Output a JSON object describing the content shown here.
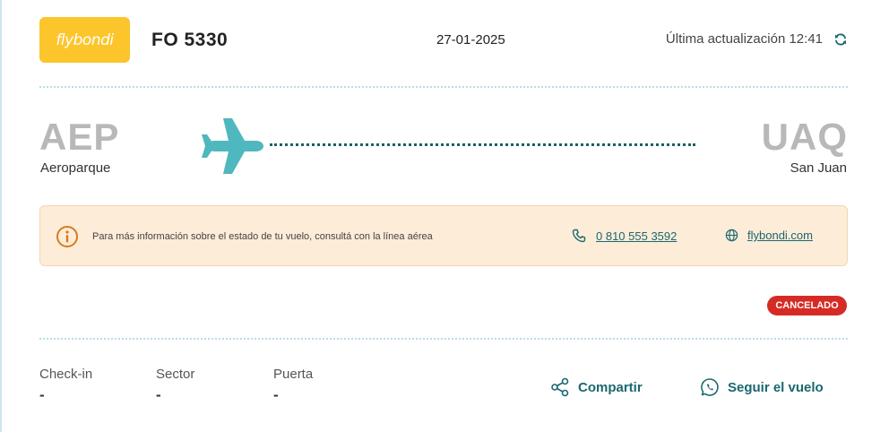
{
  "header": {
    "logo_text": "flybondi",
    "flight_number": "FO 5330",
    "date": "27-01-2025",
    "last_update": "Última actualización 12:41"
  },
  "route": {
    "origin": {
      "code": "AEP",
      "name": "Aeroparque"
    },
    "destination": {
      "code": "UAQ",
      "name": "San Juan"
    }
  },
  "info": {
    "message": "Para más información sobre el estado de tu vuelo, consultá con la línea aérea",
    "phone": "0 810 555 3592",
    "website": "flybondi.com"
  },
  "status": {
    "label": "CANCELADO",
    "color": "#d62b25"
  },
  "details": [
    {
      "label": "Check-in",
      "value": "-"
    },
    {
      "label": "Sector",
      "value": "-"
    },
    {
      "label": "Puerta",
      "value": "-"
    }
  ],
  "actions": {
    "share_label": "Compartir",
    "follow_label": "Seguir el vuelo"
  },
  "colors": {
    "brand_yellow": "#fdc52c",
    "accent_teal": "#1a6870",
    "plane_cyan": "#4fb7be",
    "info_bg": "#fdecd8",
    "info_icon": "#d97a1f"
  }
}
